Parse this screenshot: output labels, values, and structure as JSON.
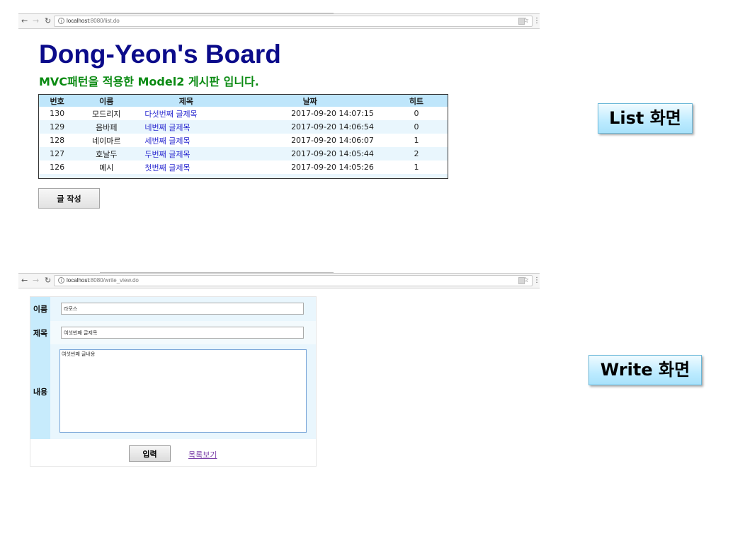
{
  "list_browser": {
    "url_host": "localhost",
    "url_rest": ":8080/list.do"
  },
  "list_page": {
    "title": "Dong-Yeon's Board",
    "subtitle": "MVC패턴을 적용한 Model2 게시판 입니다.",
    "columns": [
      "번호",
      "이름",
      "제목",
      "날짜",
      "히트"
    ],
    "rows": [
      {
        "num": "130",
        "name": "모드리지",
        "title": "다섯번째 글제목",
        "date": "2017-09-20 14:07:15",
        "hit": "0"
      },
      {
        "num": "129",
        "name": "음바페",
        "title": "네번째 글제목",
        "date": "2017-09-20 14:06:54",
        "hit": "0"
      },
      {
        "num": "128",
        "name": "네이마르",
        "title": "세번째 글제목",
        "date": "2017-09-20 14:06:07",
        "hit": "1"
      },
      {
        "num": "127",
        "name": "호날두",
        "title": "두번째 글제목",
        "date": "2017-09-20 14:05:44",
        "hit": "2"
      },
      {
        "num": "126",
        "name": "메시",
        "title": "첫번째 글제목",
        "date": "2017-09-20 14:05:26",
        "hit": "1"
      }
    ],
    "write_button": "글 작성"
  },
  "callouts": {
    "list": "List 화면",
    "write": "Write 화면"
  },
  "write_browser": {
    "url_host": "localhost",
    "url_rest": ":8080/write_view.do"
  },
  "write_page": {
    "name_label": "이름",
    "name_value": "라모스",
    "subject_label": "제목",
    "subject_value": "여섯번째 글제목",
    "content_label": "내용",
    "content_value": "여섯번째 글내용",
    "submit_button": "입력",
    "list_link": "목록보기"
  }
}
